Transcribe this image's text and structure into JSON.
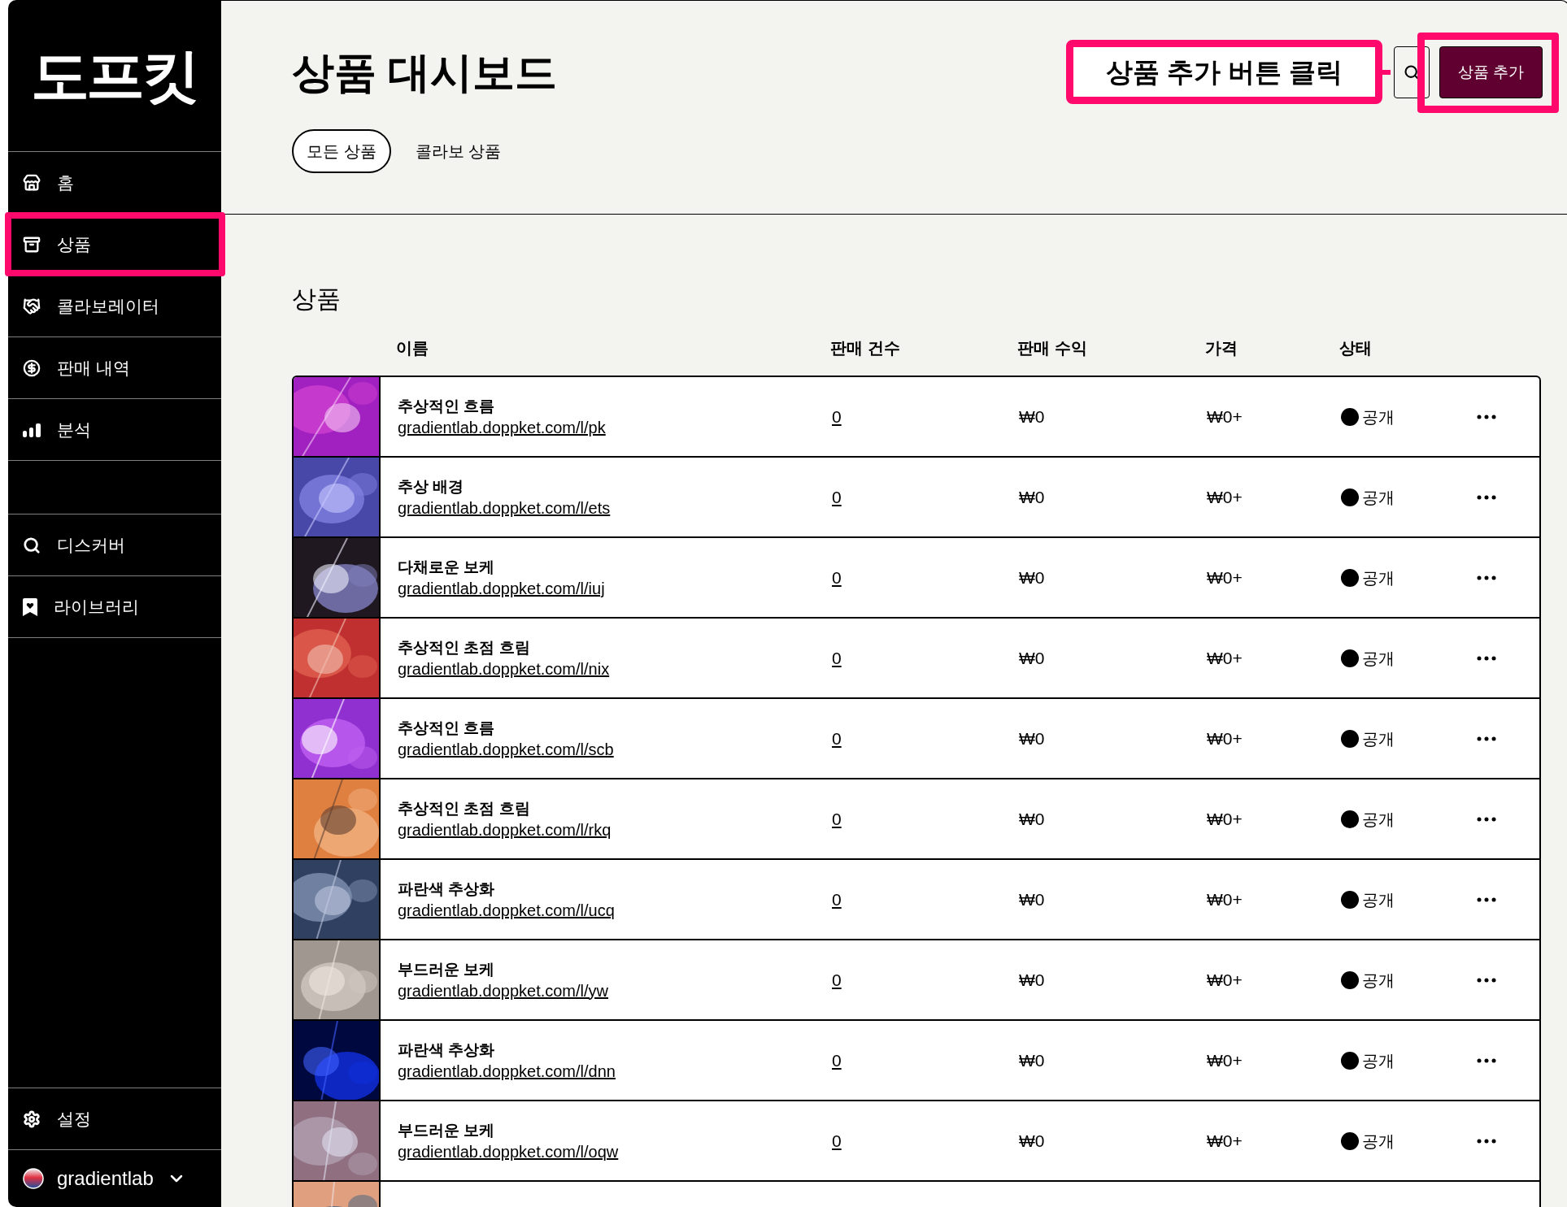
{
  "sidebar": {
    "logo": "도프킷",
    "main_items": [
      {
        "label": "홈",
        "kind": "store",
        "highlight": false
      },
      {
        "label": "상품",
        "kind": "archive",
        "highlight": true
      },
      {
        "label": "콜라보레이터",
        "kind": "handshake",
        "highlight": false
      },
      {
        "label": "판매 내역",
        "kind": "dollar",
        "highlight": false
      },
      {
        "label": "분석",
        "kind": "chart",
        "highlight": false
      }
    ],
    "secondary_items": [
      {
        "label": "디스커버",
        "kind": "search",
        "highlight": false
      },
      {
        "label": "라이브러리",
        "kind": "bookmark",
        "highlight": false
      }
    ],
    "bottom_items": [
      {
        "label": "설정",
        "kind": "settings",
        "highlight": false
      }
    ],
    "account": {
      "name": "gradientlab"
    }
  },
  "header": {
    "title": "상품 대시보드",
    "tabs": [
      {
        "label": "모든 상품",
        "selected": true
      },
      {
        "label": "콜라보 상품",
        "selected": false
      }
    ],
    "add_button": {
      "label": "상품 추가",
      "highlight": true
    },
    "callout": {
      "text": "상품 추가 버튼 클릭"
    }
  },
  "products": {
    "title": "상품",
    "columns": [
      "이름",
      "판매 건수",
      "판매 수익",
      "가격",
      "상태"
    ],
    "rows": [
      {
        "name": "추상적인 흐름",
        "url": "gradientlab.doppket.com/l/pk",
        "sales": "0",
        "revenue": "₩0",
        "price": "₩0+",
        "status": "공개"
      },
      {
        "name": "추상 배경",
        "url": "gradientlab.doppket.com/l/ets",
        "sales": "0",
        "revenue": "₩0",
        "price": "₩0+",
        "status": "공개"
      },
      {
        "name": "다채로운 보케",
        "url": "gradientlab.doppket.com/l/iuj",
        "sales": "0",
        "revenue": "₩0",
        "price": "₩0+",
        "status": "공개"
      },
      {
        "name": "추상적인 초점 흐림",
        "url": "gradientlab.doppket.com/l/nix",
        "sales": "0",
        "revenue": "₩0",
        "price": "₩0+",
        "status": "공개"
      },
      {
        "name": "추상적인 흐름",
        "url": "gradientlab.doppket.com/l/scb",
        "sales": "0",
        "revenue": "₩0",
        "price": "₩0+",
        "status": "공개"
      },
      {
        "name": "추상적인 초점 흐림",
        "url": "gradientlab.doppket.com/l/rkq",
        "sales": "0",
        "revenue": "₩0",
        "price": "₩0+",
        "status": "공개"
      },
      {
        "name": "파란색 추상화",
        "url": "gradientlab.doppket.com/l/ucq",
        "sales": "0",
        "revenue": "₩0",
        "price": "₩0+",
        "status": "공개"
      },
      {
        "name": "부드러운 보케",
        "url": "gradientlab.doppket.com/l/yw",
        "sales": "0",
        "revenue": "₩0",
        "price": "₩0+",
        "status": "공개"
      },
      {
        "name": "파란색 추상화",
        "url": "gradientlab.doppket.com/l/dnn",
        "sales": "0",
        "revenue": "₩0",
        "price": "₩0+",
        "status": "공개"
      },
      {
        "name": "부드러운 보케",
        "url": "gradientlab.doppket.com/l/oqw",
        "sales": "0",
        "revenue": "₩0",
        "price": "₩0+",
        "status": "공개"
      }
    ]
  }
}
